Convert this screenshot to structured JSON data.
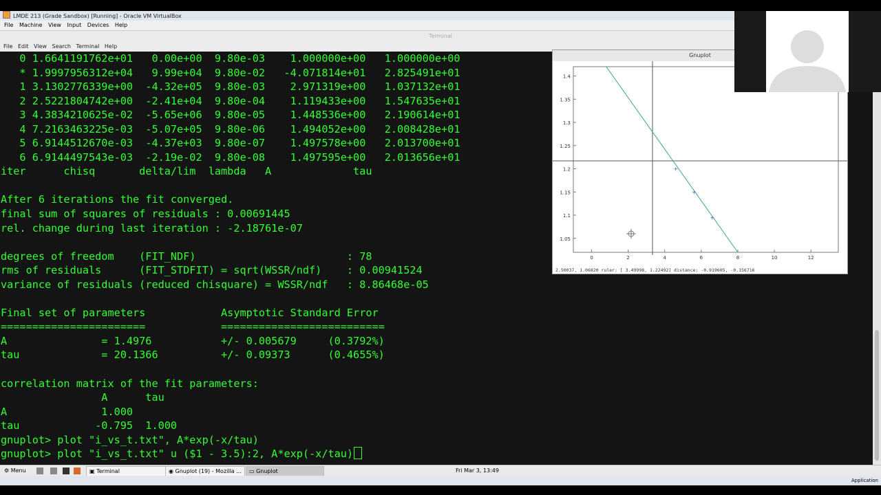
{
  "vbox": {
    "title": "LMDE 213 (Grade Sandbox) [Running] - Oracle VM VirtualBox",
    "menu": [
      "File",
      "Machine",
      "View",
      "Input",
      "Devices",
      "Help"
    ]
  },
  "terminal": {
    "title": "Terminal",
    "menu": [
      "File",
      "Edit",
      "View",
      "Search",
      "Terminal",
      "Help"
    ],
    "lines": [
      "   0 1.6641191762e+01   0.00e+00  9.80e-03    1.000000e+00   1.000000e+00",
      "   * 1.9997956312e+04   9.99e+04  9.80e-02   -4.071814e+01   2.825491e+01",
      "   1 3.1302776339e+00  -4.32e+05  9.80e-03    2.971319e+00   1.037132e+01",
      "   2 2.5221804742e+00  -2.41e+04  9.80e-04    1.119433e+00   1.547635e+01",
      "   3 4.3834210625e-02  -5.65e+06  9.80e-05    1.448536e+00   2.190614e+01",
      "   4 7.2163463225e-03  -5.07e+05  9.80e-06    1.494052e+00   2.008428e+01",
      "   5 6.9144512670e-03  -4.37e+03  9.80e-07    1.497578e+00   2.013700e+01",
      "   6 6.9144497543e-03  -2.19e-02  9.80e-08    1.497595e+00   2.013656e+01",
      "iter      chisq       delta/lim  lambda   A             tau",
      "",
      "After 6 iterations the fit converged.",
      "final sum of squares of residuals : 0.00691445",
      "rel. change during last iteration : -2.18761e-07",
      "",
      "degrees of freedom    (FIT_NDF)                        : 78",
      "rms of residuals      (FIT_STDFIT) = sqrt(WSSR/ndf)    : 0.00941524",
      "variance of residuals (reduced chisquare) = WSSR/ndf   : 8.86468e-05",
      "",
      "Final set of parameters            Asymptotic Standard Error",
      "=======================            ==========================",
      "A               = 1.4976           +/- 0.005679     (0.3792%)",
      "tau             = 20.1366          +/- 0.09373      (0.4655%)",
      "",
      "correlation matrix of the fit parameters:",
      "                A      tau",
      "A               1.000",
      "tau            -0.795  1.000",
      "gnuplot> plot \"i_vs_t.txt\", A*exp(-x/tau)",
      "gnuplot> plot \"i_vs_t.txt\" u ($1 - 3.5):2, A*exp(-x/tau)"
    ]
  },
  "gnuplot": {
    "title": "Gnuplot",
    "status": "2.50037,  1.06820  ruler: [ 3.49998,  1.22492]  distance: -0.919605, -0.156716",
    "y_ticks": [
      "1.4",
      "1.35",
      "1.3",
      "1.25",
      "1.2",
      "1.15",
      "1.1",
      "1.05"
    ],
    "x_ticks": [
      "0",
      "2",
      "4",
      "6",
      "8",
      "10",
      "12"
    ],
    "line_color": "#3aa87a",
    "points_color": "#4444cc"
  },
  "chart_data": {
    "type": "line",
    "series": [
      {
        "values_x": [
          0.8,
          8.0
        ],
        "values_y": [
          1.42,
          1.02
        ]
      },
      {
        "points_x": [
          4.6,
          5.6,
          6.6
        ],
        "points_y": [
          1.2,
          1.15,
          1.095
        ]
      }
    ],
    "xlim": [
      -1,
      13.5
    ],
    "ylim": [
      1.02,
      1.42
    ]
  },
  "taskbar": {
    "menu": "Menu",
    "items": [
      "Terminal",
      "Gnuplot (19) - Mozilla ...",
      "Gnuplot"
    ],
    "clock": "Fri Mar  3, 13:49"
  },
  "vbstatus": {
    "right": "Application"
  }
}
